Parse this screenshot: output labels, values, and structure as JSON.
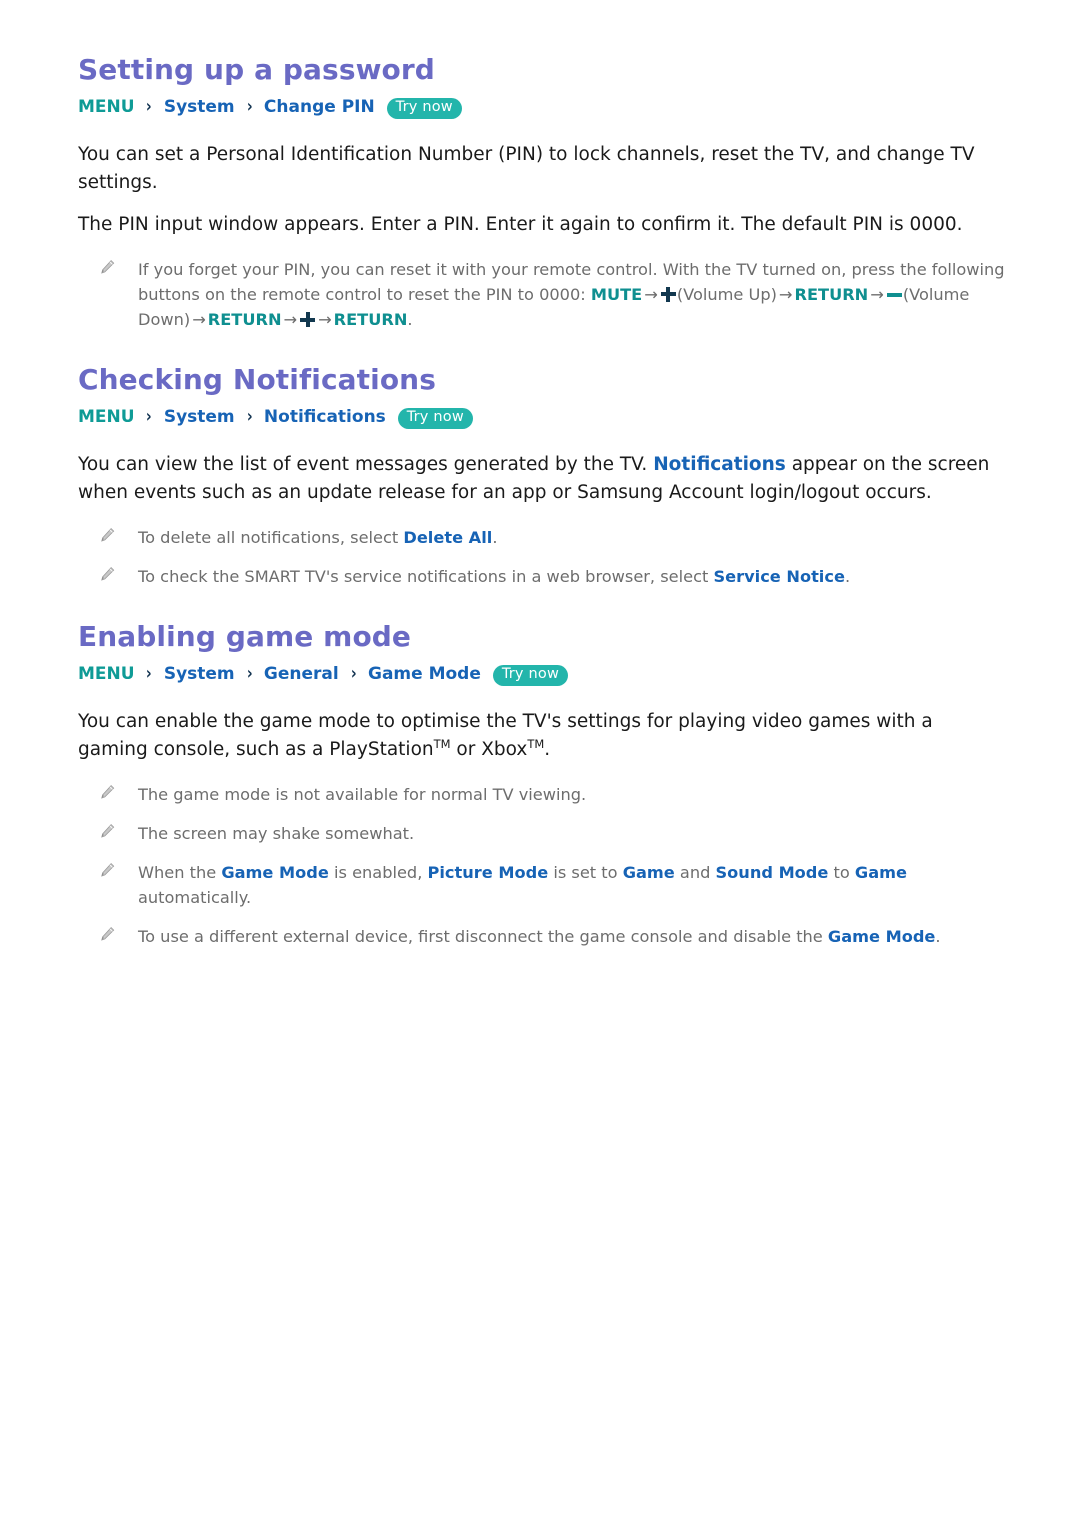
{
  "document": {
    "sections": [
      {
        "id": "setting-up-a-password",
        "title": "Setting up a password",
        "breadcrumb": {
          "root": "MENU",
          "separator": "›",
          "items": [
            "System",
            "Change PIN"
          ],
          "try_now": "Try now"
        },
        "paragraphs": [
          "You can set a Personal Identification Number (PIN) to lock channels, reset the TV, and change TV settings.",
          "The PIN input window appears. Enter a PIN. Enter it again to confirm it. The default PIN is 0000."
        ],
        "notes": [
          {
            "text_1": "If you forget your PIN, you can reset it with your remote control. With the TV turned on, press the following buttons on the remote control to reset the PIN to 0000: ",
            "key_mute": "MUTE",
            "arrow": "→",
            "vol_up_label": "(Volume Up)",
            "key_return_1": "RETURN",
            "vol_down_label": "(Volume",
            "text_2": "Down)",
            "key_return_2": "RETURN",
            "key_return_3": "RETURN",
            "period": "."
          }
        ]
      },
      {
        "id": "checking-notifications",
        "title": "Checking Notifications",
        "breadcrumb": {
          "root": "MENU",
          "separator": "›",
          "items": [
            "System",
            "Notifications"
          ],
          "try_now": "Try now"
        },
        "paragraph_parts": {
          "before": "You can view the list of event messages generated by the TV. ",
          "highlight": "Notifications",
          "after": " appear on the screen when events such as an update release for an app or Samsung Account login/logout occurs."
        },
        "notes": [
          {
            "before": "To delete all notifications, select ",
            "highlight": "Delete All",
            "after": "."
          },
          {
            "before": "To check the SMART TV's service notifications in a web browser, select ",
            "highlight": "Service Notice",
            "after": "."
          }
        ]
      },
      {
        "id": "enabling-game-mode",
        "title": "Enabling game mode",
        "breadcrumb": {
          "root": "MENU",
          "separator": "›",
          "items": [
            "System",
            "General",
            "Game Mode"
          ],
          "try_now": "Try now"
        },
        "paragraph_parts": {
          "before": "You can enable the game mode to optimise the TV's settings for playing video games with a gaming console, such as a PlayStation",
          "tm_1": "TM",
          "middle": " or Xbox",
          "tm_2": "TM",
          "after": "."
        },
        "notes": [
          {
            "plain": "The game mode is not available for normal TV viewing."
          },
          {
            "plain": "The screen may shake somewhat."
          },
          {
            "p1": "When the ",
            "h1": "Game Mode",
            "p2": " is enabled, ",
            "h2": "Picture Mode",
            "p3": " is set to ",
            "h3": "Game",
            "p4": " and ",
            "h4": "Sound Mode",
            "p5": " to ",
            "h5": "Game",
            "p6": " automatically."
          },
          {
            "before": "To use a different external device, first disconnect the game console and disable the ",
            "highlight": "Game Mode",
            "after": "."
          }
        ]
      }
    ],
    "icons": {
      "pencil": "pencil-icon"
    },
    "colors": {
      "heading": "#6a6ac4",
      "menu_root": "#0f9b96",
      "breadcrumb_item": "#1763b5",
      "try_now_bg": "#23b5ab",
      "note_text": "#6d6d6d",
      "keyword_teal": "#0f8f90",
      "keyword_blue": "#1763b5"
    }
  }
}
